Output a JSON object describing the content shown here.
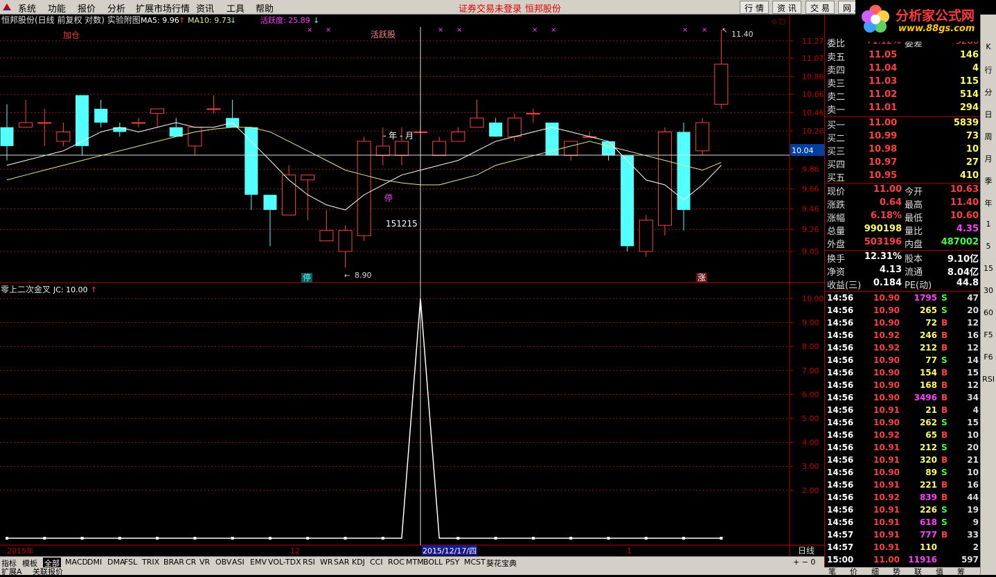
{
  "menu": {
    "items": [
      "系统",
      "功能",
      "报价",
      "分析",
      "扩展市场行情",
      "资讯",
      "工具",
      "帮助"
    ],
    "status": "证券交易未登录",
    "stock": "恒邦股份",
    "buttons": [
      "行 情",
      "资 讯",
      "交 易",
      "网 上"
    ]
  },
  "brand": {
    "title": "分析家公式网",
    "url": "www.88gs.com"
  },
  "header": {
    "title": "恒邦股份(日线 前复权 对数) 实验附图",
    "ma5": "MA5: 9.96",
    "ma10": "MA10: 9.73",
    "activity": "活跃度: 25.89"
  },
  "indicator": {
    "title": "零上二次金叉",
    "jc": "JC: 10.00"
  },
  "annotations": {
    "jiacang": "加仓",
    "huoyuegu": "活跃股",
    "yearmonth": "- 年 - 月",
    "ting": "停",
    "ting2": "停",
    "zhang": "涨",
    "date_label": "151215",
    "high_label": "11.40",
    "low_label": "8.90",
    "cross_price": "10.04",
    "cross_date": "2015/12/17/四",
    "xaxis": [
      "2015年",
      "12",
      "1"
    ],
    "period": "日线"
  },
  "chart_data": {
    "type": "candlestick",
    "price_ticks": [
      "11.27",
      "11.07",
      "10.86",
      "10.66",
      "10.46",
      "10.26",
      "10.04",
      "9.86",
      "9.66",
      "9.46",
      "9.26",
      "9.05"
    ],
    "indicator_ticks": [
      "10.00",
      "9.00",
      "8.00",
      "7.00",
      "6.00",
      "5.00",
      "4.00",
      "3.00",
      "2.00"
    ],
    "candles": [
      [
        10.3,
        10.1,
        10.55,
        9.95
      ],
      [
        10.3,
        10.35,
        10.6,
        10.3
      ],
      [
        10.35,
        10.35,
        10.5,
        10.1
      ],
      [
        10.15,
        10.25,
        10.35,
        10.1
      ],
      [
        10.65,
        10.1,
        10.65,
        10.0
      ],
      [
        10.5,
        10.35,
        10.6,
        10.3
      ],
      [
        10.3,
        10.25,
        10.35,
        10.2
      ],
      [
        10.35,
        10.35,
        10.4,
        10.3
      ],
      [
        10.45,
        10.5,
        10.5,
        10.3
      ],
      [
        10.3,
        10.2,
        10.4,
        10.2
      ],
      [
        10.1,
        10.3,
        10.3,
        10.0
      ],
      [
        10.5,
        10.5,
        10.65,
        10.45
      ],
      [
        10.4,
        10.3,
        10.6,
        10.3
      ],
      [
        10.3,
        9.6,
        10.3,
        9.45
      ],
      [
        9.6,
        9.45,
        9.55,
        9.1
      ],
      [
        9.4,
        9.8,
        9.9,
        9.5
      ],
      [
        9.75,
        9.8,
        9.8,
        9.35
      ],
      [
        9.15,
        9.25,
        9.45,
        9.2
      ],
      [
        9.05,
        9.25,
        9.3,
        8.9
      ],
      [
        9.2,
        10.15,
        10.2,
        9.15
      ],
      [
        10.0,
        10.1,
        10.3,
        9.9
      ],
      [
        10.0,
        10.15,
        10.3,
        9.9
      ],
      [
        10.25,
        10.25,
        10.3,
        10.15
      ],
      [
        10.0,
        10.15,
        10.2,
        10.0
      ],
      [
        10.15,
        10.25,
        10.3,
        10.15
      ],
      [
        10.3,
        10.4,
        10.6,
        10.3
      ],
      [
        10.35,
        10.2,
        10.4,
        10.2
      ],
      [
        10.2,
        10.4,
        10.45,
        10.15
      ],
      [
        10.45,
        10.45,
        10.5,
        10.35
      ],
      [
        10.35,
        10.0,
        10.35,
        10.0
      ],
      [
        10.0,
        10.15,
        10.15,
        9.95
      ],
      [
        10.2,
        10.2,
        10.25,
        10.2
      ],
      [
        10.15,
        10.0,
        10.15,
        9.95
      ],
      [
        10.0,
        9.1,
        10.0,
        9.05
      ],
      [
        9.05,
        9.35,
        9.4,
        9.0
      ],
      [
        9.3,
        10.25,
        10.3,
        9.2
      ],
      [
        10.25,
        9.45,
        10.35,
        9.25
      ],
      [
        10.05,
        10.35,
        10.4,
        10.0
      ],
      [
        10.55,
        11.0,
        11.4,
        10.5
      ]
    ],
    "ma5": [
      9.9,
      9.95,
      10.0,
      10.05,
      10.15,
      10.25,
      10.3,
      10.25,
      10.3,
      10.35,
      10.3,
      10.3,
      10.35,
      10.15,
      9.95,
      9.75,
      9.6,
      9.5,
      9.45,
      9.6,
      9.7,
      9.8,
      9.85,
      9.9,
      9.95,
      10.05,
      10.15,
      10.2,
      10.25,
      10.3,
      10.25,
      10.2,
      10.15,
      9.95,
      9.75,
      9.7,
      9.55,
      9.7,
      9.9
    ],
    "ma10": [
      9.75,
      9.8,
      9.85,
      9.9,
      9.95,
      10.0,
      10.05,
      10.1,
      10.15,
      10.2,
      10.25,
      10.28,
      10.3,
      10.3,
      10.25,
      10.15,
      10.05,
      9.95,
      9.85,
      9.8,
      9.75,
      9.72,
      9.7,
      9.7,
      9.75,
      9.8,
      9.9,
      9.95,
      10.0,
      10.05,
      10.1,
      10.15,
      10.1,
      10.05,
      10.0,
      9.95,
      9.9,
      9.85,
      9.93
    ],
    "jc_index": 22,
    "jc_value": 10.0,
    "crosshair_index": 22
  },
  "quotes": {
    "committee": {
      "label": "委比",
      "value": "71.12%",
      "label2": "委差",
      "value2": "5286"
    },
    "asks": [
      {
        "label": "卖五",
        "price": "11.05",
        "vol": "146"
      },
      {
        "label": "卖四",
        "price": "11.04",
        "vol": "4"
      },
      {
        "label": "卖三",
        "price": "11.03",
        "vol": "115"
      },
      {
        "label": "卖二",
        "price": "11.02",
        "vol": "514"
      },
      {
        "label": "卖一",
        "price": "11.01",
        "vol": "294"
      }
    ],
    "bids": [
      {
        "label": "买一",
        "price": "11.00",
        "vol": "5839"
      },
      {
        "label": "买二",
        "price": "10.99",
        "vol": "73"
      },
      {
        "label": "买三",
        "price": "10.98",
        "vol": "10"
      },
      {
        "label": "买四",
        "price": "10.97",
        "vol": "27"
      },
      {
        "label": "买五",
        "price": "10.95",
        "vol": "410"
      }
    ],
    "stats": [
      {
        "l1": "现价",
        "v1": "11.00",
        "c1": "#ff4040",
        "l2": "今开",
        "v2": "10.63",
        "c2": "#ff4040"
      },
      {
        "l1": "涨跌",
        "v1": "0.64",
        "c1": "#ff4040",
        "l2": "最高",
        "v2": "11.40",
        "c2": "#ff4040"
      },
      {
        "l1": "涨幅",
        "v1": "6.18%",
        "c1": "#ff4040",
        "l2": "最低",
        "v2": "10.60",
        "c2": "#ff4040"
      },
      {
        "l1": "总量",
        "v1": "990198",
        "c1": "#ffff60",
        "l2": "量比",
        "v2": "4.35",
        "c2": "#ff40ff"
      },
      {
        "l1": "外盘",
        "v1": "503196",
        "c1": "#ff4040",
        "l2": "内盘",
        "v2": "487002",
        "c2": "#40ff40"
      }
    ],
    "fin": [
      {
        "l1": "换手",
        "v1": "12.31%",
        "l2": "股本",
        "v2": "9.10亿"
      },
      {
        "l1": "净资",
        "v1": "4.13",
        "l2": "流通",
        "v2": "8.04亿"
      },
      {
        "l1": "收益(三)",
        "v1": "0.184",
        "l2": "PE(动)",
        "v2": "44.8"
      }
    ]
  },
  "ticks": [
    {
      "t": "14:56",
      "p": "10.90",
      "v": "1795",
      "s": "S",
      "n": "47",
      "vc": "#ff40ff"
    },
    {
      "t": "14:56",
      "p": "10.90",
      "v": "265",
      "s": "S",
      "n": "20",
      "vc": "#ffff60"
    },
    {
      "t": "14:56",
      "p": "10.90",
      "v": "72",
      "s": "B",
      "n": "12",
      "vc": "#ffff60"
    },
    {
      "t": "14:56",
      "p": "10.92",
      "v": "246",
      "s": "B",
      "n": "16",
      "vc": "#ffff60"
    },
    {
      "t": "14:56",
      "p": "10.92",
      "v": "212",
      "s": "B",
      "n": "12",
      "vc": "#ffff60"
    },
    {
      "t": "14:56",
      "p": "10.90",
      "v": "77",
      "s": "S",
      "n": "14",
      "vc": "#ffff60"
    },
    {
      "t": "14:56",
      "p": "10.90",
      "v": "154",
      "s": "B",
      "n": "15",
      "vc": "#ffff60"
    },
    {
      "t": "14:56",
      "p": "10.90",
      "v": "168",
      "s": "B",
      "n": "12",
      "vc": "#ffff60"
    },
    {
      "t": "14:56",
      "p": "10.90",
      "v": "3496",
      "s": "B",
      "n": "34",
      "vc": "#ff40ff"
    },
    {
      "t": "14:56",
      "p": "10.91",
      "v": "21",
      "s": "B",
      "n": "4",
      "vc": "#ffff60"
    },
    {
      "t": "14:56",
      "p": "10.90",
      "v": "262",
      "s": "S",
      "n": "15",
      "vc": "#ffff60"
    },
    {
      "t": "14:56",
      "p": "10.92",
      "v": "65",
      "s": "B",
      "n": "10",
      "vc": "#ffff60"
    },
    {
      "t": "14:56",
      "p": "10.91",
      "v": "212",
      "s": "S",
      "n": "20",
      "vc": "#ffff60"
    },
    {
      "t": "14:56",
      "p": "10.91",
      "v": "320",
      "s": "B",
      "n": "21",
      "vc": "#ffff60"
    },
    {
      "t": "14:56",
      "p": "10.90",
      "v": "89",
      "s": "S",
      "n": "10",
      "vc": "#ffff60"
    },
    {
      "t": "14:56",
      "p": "10.91",
      "v": "221",
      "s": "B",
      "n": "16",
      "vc": "#ffff60"
    },
    {
      "t": "14:56",
      "p": "10.92",
      "v": "839",
      "s": "B",
      "n": "44",
      "vc": "#ff40ff"
    },
    {
      "t": "14:56",
      "p": "10.91",
      "v": "226",
      "s": "S",
      "n": "19",
      "vc": "#ffff60"
    },
    {
      "t": "14:56",
      "p": "10.91",
      "v": "618",
      "s": "S",
      "n": "9",
      "vc": "#ff40ff"
    },
    {
      "t": "14:57",
      "p": "10.91",
      "v": "777",
      "s": "B",
      "n": "33",
      "vc": "#ff40ff"
    },
    {
      "t": "14:57",
      "p": "10.91",
      "v": "110",
      "s": "",
      "n": "2",
      "vc": "#ffff60"
    },
    {
      "t": "15:00",
      "p": "11.00",
      "v": "11916",
      "s": "",
      "n": "597",
      "vc": "#ff40ff"
    }
  ],
  "tabs": [
    "指标",
    "模板",
    "全部",
    "MACD",
    "DMI",
    "DMA",
    "FSL",
    "TRIX",
    "BRAR",
    "CR",
    "VR",
    "OBV",
    "ASI",
    "EMV",
    "VOL-TDX",
    "RSI",
    "WR",
    "SAR",
    "KDJ",
    "CCI",
    "ROC",
    "MTM",
    "BOLL",
    "PSY",
    "MCST",
    "葵花宝典"
  ],
  "bottom": {
    "left": "扩展A",
    "right": "关联报价",
    "rp_tabs": [
      "笔",
      "价",
      "细",
      "势",
      "联",
      "值",
      "筹"
    ]
  },
  "sidebar": [
    "K",
    "行",
    "分",
    "日",
    "周",
    "月",
    "季",
    "年",
    "1",
    "5",
    "15",
    "30",
    "60",
    "F5",
    "F6",
    "RSI"
  ],
  "colors": {
    "up": "#ff4040",
    "down": "#54ffff",
    "ma5": "#ffffff",
    "ma10": "#e6e68a",
    "grid": "#8a1a1a",
    "axis": "#c00000"
  }
}
